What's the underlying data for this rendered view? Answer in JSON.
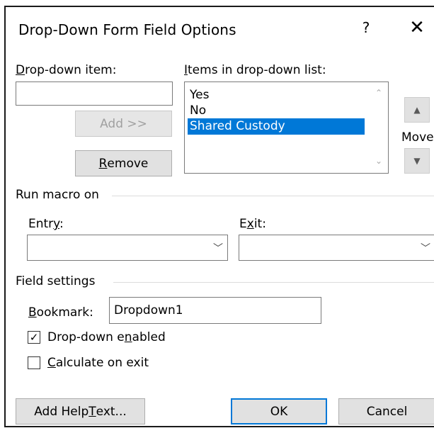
{
  "dialog": {
    "title": "Drop-Down Form Field Options",
    "help": "?",
    "close": "✕"
  },
  "dropdown_item": {
    "label_prefix": "D",
    "label_rest": "rop-down item:",
    "value": "",
    "add_button": "Add >>",
    "remove_prefix": "R",
    "remove_rest": "emove"
  },
  "items_list": {
    "label_prefix": "I",
    "label_rest": "tems in drop-down list:",
    "items": [
      "Yes",
      "No",
      "Shared Custody"
    ],
    "selected_index": 2,
    "scroll_up": "⌃",
    "scroll_down": "⌄"
  },
  "move": {
    "label": "Move",
    "up": "▲",
    "down": "▼"
  },
  "run_macro": {
    "heading": "Run macro on",
    "entry_label_a": "Entr",
    "entry_label_u": "y",
    "entry_label_b": ":",
    "entry_value": "",
    "exit_label_a": "E",
    "exit_label_u": "x",
    "exit_label_b": "it:",
    "exit_value": "",
    "chevron": "﹀"
  },
  "field_settings": {
    "heading": "Field settings",
    "bookmark_label_u": "B",
    "bookmark_label_rest": "ookmark:",
    "bookmark_value": "Dropdown1",
    "enabled_a": "Drop-down e",
    "enabled_u": "n",
    "enabled_b": "abled",
    "enabled_checked": true,
    "enabled_mark": "✓",
    "calc_u": "C",
    "calc_rest": "alculate on exit",
    "calc_checked": false
  },
  "footer": {
    "help_text_a": "Add Help ",
    "help_text_u": "T",
    "help_text_b": "ext...",
    "ok": "OK",
    "cancel": "Cancel"
  }
}
